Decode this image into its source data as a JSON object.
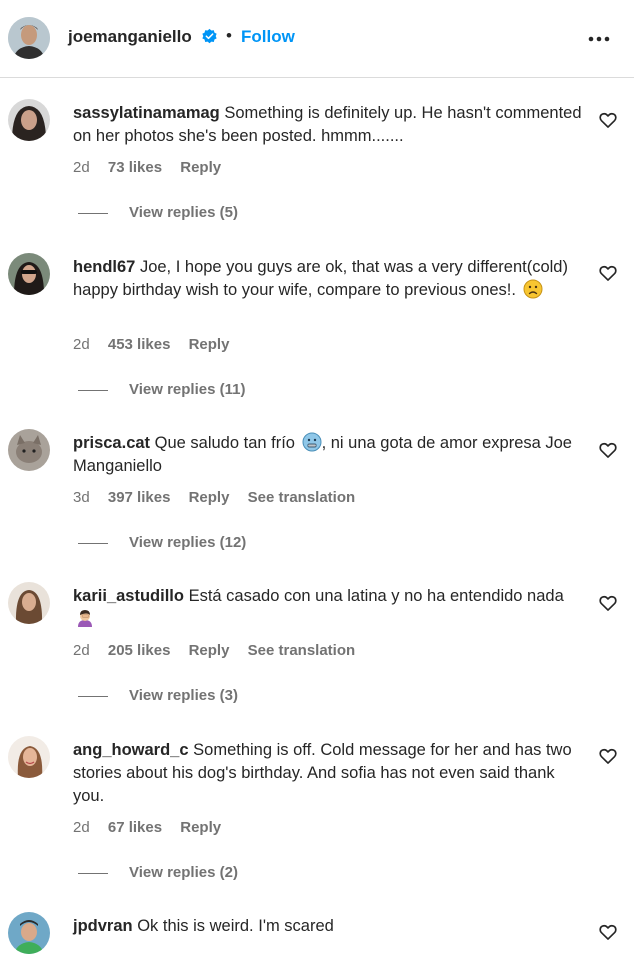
{
  "header": {
    "username": "joemanganiello",
    "separator": "•",
    "follow_label": "Follow"
  },
  "comments": [
    {
      "username": "sassylatinamamag",
      "text": "Something is definitely up. He hasn't commented on her photos she's been posted. hmmm.......",
      "age": "2d",
      "likes": "73 likes",
      "reply": "Reply",
      "view_replies": "View replies (5)"
    },
    {
      "username": "hendl67",
      "text": "Joe, I hope you guys are ok, that was a very different(cold) happy birthday wish to your wife, compare to previous ones!.",
      "emoji": "sad-face-emoji",
      "age": "2d",
      "likes": "453 likes",
      "reply": "Reply",
      "view_replies": "View replies (11)"
    },
    {
      "username": "prisca.cat",
      "text_before": "Que saludo tan frío",
      "emoji": "cold-face-emoji",
      "text_after": ", ni una gota de amor expresa Joe Manganiello",
      "age": "3d",
      "likes": "397 likes",
      "reply": "Reply",
      "translate": "See translation",
      "view_replies": "View replies (12)"
    },
    {
      "username": "karii_astudillo",
      "text": "Está casado con una latina y no ha entendido nada",
      "emoji": "facepalm-emoji",
      "age": "2d",
      "likes": "205 likes",
      "reply": "Reply",
      "translate": "See translation",
      "view_replies": "View replies (3)"
    },
    {
      "username": "ang_howard_c",
      "text": "Something is off. Cold message for her and has two stories about his dog's birthday. And sofia has not even said thank you.",
      "age": "2d",
      "likes": "67 likes",
      "reply": "Reply",
      "view_replies": "View replies (2)"
    },
    {
      "username": "jpdvran",
      "text": "Ok this is weird. I'm scared"
    }
  ],
  "colors": {
    "link_blue": "#0095f6",
    "text": "#262626",
    "secondary": "#737373",
    "verified": "#0095f6"
  }
}
